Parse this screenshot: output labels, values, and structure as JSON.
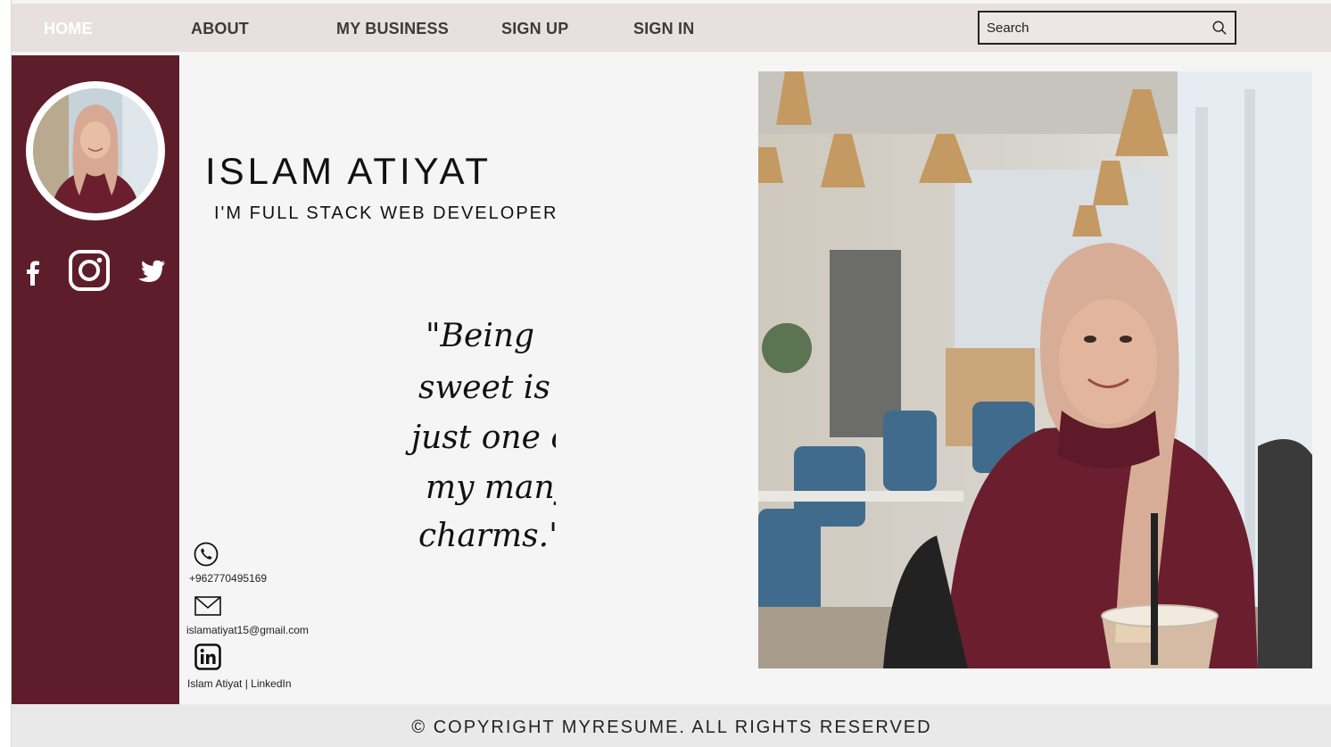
{
  "nav": {
    "items": [
      {
        "label": "HOME",
        "active": true
      },
      {
        "label": "ABOUT",
        "active": false
      },
      {
        "label": "MY BUSINESS",
        "active": false
      },
      {
        "label": "SIGN UP",
        "active": false
      },
      {
        "label": "SIGN IN",
        "active": false
      }
    ],
    "search_placeholder": "Search",
    "search_icon": "search-icon"
  },
  "sidebar": {
    "avatar_alt": "profile-photo",
    "socials": [
      "facebook-icon",
      "instagram-icon",
      "twitter-icon"
    ]
  },
  "hero": {
    "name": "ISLAM ATIYAT",
    "role": "I'M FULL STACK WEB DEVELOPER",
    "quote_lines": [
      "\"Being",
      "sweet is",
      "just one of",
      "my many",
      "charms.\""
    ]
  },
  "contact": {
    "phone": "+962770495169",
    "email": "islamatiyat15@gmail.com",
    "linkedin": "Islam Atiyat | LinkedIn"
  },
  "footer": {
    "text": "© COPYRIGHT MYRESUME. ALL RIGHTS RESERVED"
  },
  "colors": {
    "sidebar": "#5e1d2a",
    "nav_bg": "#e8e0df",
    "page_bg": "#f5f5f5"
  }
}
